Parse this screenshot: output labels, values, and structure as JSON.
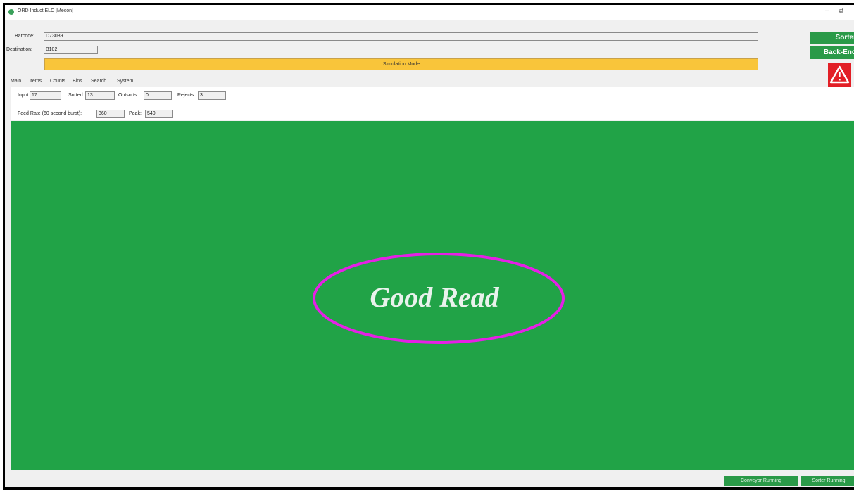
{
  "window": {
    "title": "ORD Induct ELC [Mecon]",
    "minimize_glyph": "–",
    "restore_glyph": "⧉"
  },
  "header": {
    "barcode_label": "Barcode:",
    "barcode_value": "D73039",
    "destination_label": "Destination:",
    "destination_value": "B102",
    "simulation_label": "Simulation Mode"
  },
  "side_buttons": {
    "sorter_label": "Sorter",
    "backend_label": "Back-End",
    "warning_icon": "warning-triangle-icon"
  },
  "tabs": [
    "Main",
    "Items",
    "Counts",
    "Bins",
    "Search",
    "System"
  ],
  "counts": {
    "input_label": "Input:",
    "input_value": "17",
    "sorted_label": "Sorted:",
    "sorted_value": "13",
    "outsorts_label": "Outsorts:",
    "outsorts_value": "0",
    "rejects_label": "Rejects:",
    "rejects_value": "3"
  },
  "rates": {
    "feed_rate_label": "Feed Rate (60 second burst):",
    "feed_rate_value": "360",
    "peak_label": "Peak:",
    "peak_value": "540"
  },
  "status_panel": {
    "message": "Good Read",
    "background_color": "#21a347",
    "highlight_color": "#e61fe6"
  },
  "footer": {
    "conveyor_status": "Conveyor Running",
    "sorter_status": "Sorter Running"
  }
}
